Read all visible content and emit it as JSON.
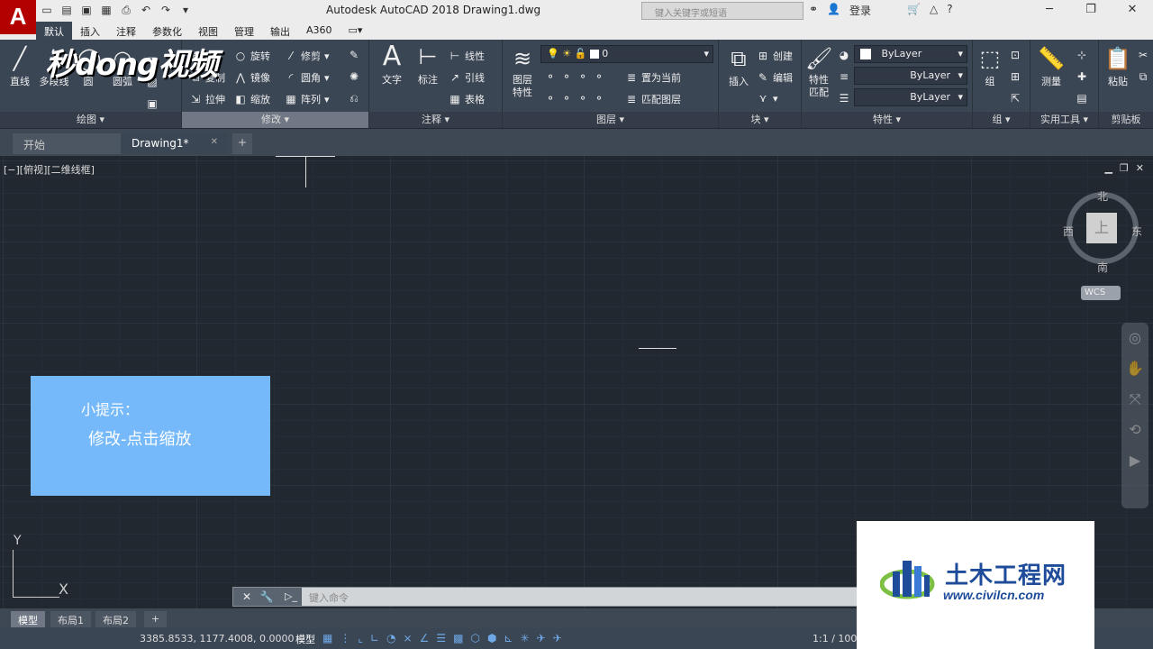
{
  "titlebar": {
    "app_letter": "A",
    "title": "Autodesk AutoCAD 2018    Drawing1.dwg",
    "search_placeholder": "键入关键字或短语",
    "login": "登录",
    "help": "?"
  },
  "ribbon_tabs": [
    "默认",
    "插入",
    "注释",
    "参数化",
    "视图",
    "管理",
    "输出",
    "A360"
  ],
  "watermark": "秒dong视频",
  "panels": {
    "draw": {
      "title": "绘图 ▾",
      "line": "直线",
      "polyline": "多段线",
      "circle": "圆",
      "arc": "圆弧"
    },
    "modify": {
      "title": "修改 ▾",
      "move": "动",
      "rotate": "旋转",
      "trim": "修剪",
      "copy": "复制",
      "mirror": "镜像",
      "fillet": "圆角",
      "stretch": "拉伸",
      "scale": "缩放",
      "array": "阵列"
    },
    "annotation": {
      "title": "注释 ▾",
      "text": "文字",
      "dimension": "标注",
      "linear": "线性",
      "leader": "引线",
      "table": "表格"
    },
    "layers": {
      "title": "图层 ▾",
      "layer_props": "图层\n特性",
      "layer_value": "0",
      "make_current": "置为当前",
      "match_layer": "匹配图层"
    },
    "block": {
      "title": "块 ▾",
      "insert": "插入",
      "create": "创建",
      "edit": "编辑"
    },
    "properties": {
      "title": "特性 ▾",
      "match": "特性\n匹配",
      "color": "ByLayer",
      "linetype": "ByLayer",
      "lineweight": "ByLayer"
    },
    "group": {
      "title": "组 ▾",
      "group": "组"
    },
    "utilities": {
      "title": "实用工具 ▾",
      "measure": "测量"
    },
    "clipboard": {
      "title": "剪贴板",
      "paste": "粘贴"
    }
  },
  "doc_tabs": {
    "start": "开始",
    "drawing": "Drawing1*",
    "close": "✕",
    "add": "+"
  },
  "viewport": {
    "label": "[−][俯视][二维线框]",
    "compass": {
      "north": "北",
      "south": "南",
      "east": "东",
      "west": "西",
      "top": "上"
    },
    "wcs": "WCS"
  },
  "tip": {
    "title": "小提示：",
    "text": "修改-点击缩放"
  },
  "ucs": {
    "x": "X",
    "y": "Y"
  },
  "cmdline": {
    "placeholder": "键入命令",
    "prompt": "▷_"
  },
  "layout_tabs": [
    "模型",
    "布局1",
    "布局2",
    "+"
  ],
  "status": {
    "coords": "3385.8533, 1177.4008, 0.0000",
    "model": "模型",
    "scale": "1:1 / 100%"
  },
  "logo": {
    "name": "土木工程网",
    "url": "www.civilcn.com"
  }
}
